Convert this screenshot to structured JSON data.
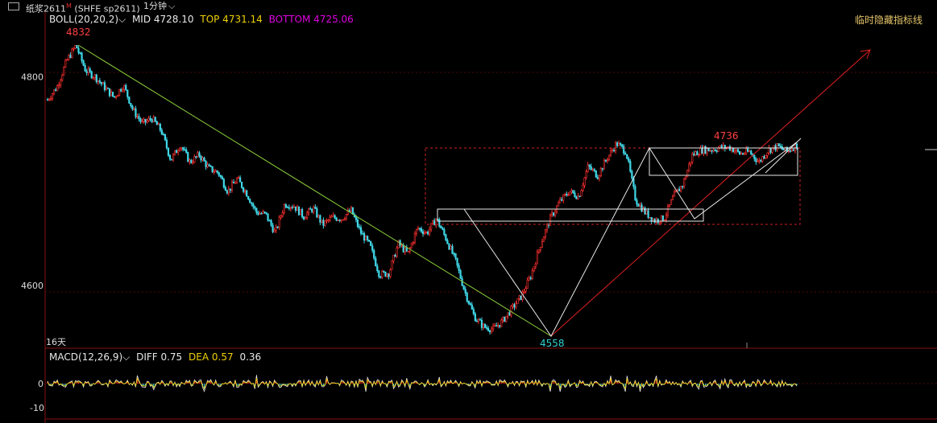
{
  "header": {
    "symbol": "纸浆2611",
    "symbol_mark": "M",
    "exchange": "(SHFE sp2611)",
    "timeframe": "1分钟"
  },
  "boll": {
    "label": "BOLL(20,20,2)",
    "mid": "MID 4728.10",
    "top": "TOP 4731.14",
    "bottom": "BOTTOM 4725.06",
    "colors": {
      "label": "#e8e8e8",
      "mid": "#e8e8e8",
      "top": "#f0d000",
      "bottom": "#e000e0"
    }
  },
  "hide_indicator_label": "临时隐藏指标线",
  "period_label": "16天",
  "macd": {
    "label": "MACD(12,26,9)",
    "diff": "DIFF 0.75",
    "dea": "DEA 0.57",
    "value": "0.36",
    "yticks": [
      "0",
      "-10"
    ]
  },
  "chart_data": {
    "type": "candlestick",
    "yticks": [
      4800,
      4600
    ],
    "ylim": [
      4542,
      4848
    ],
    "annotations": [
      {
        "text": "4832",
        "price": 4832,
        "color": "#ff4040"
      },
      {
        "text": "4736",
        "price": 4736,
        "color": "#ff4040"
      },
      {
        "text": "4558",
        "price": 4558,
        "color": "#30d0d0"
      }
    ],
    "series": [
      {
        "values": [
          4778,
          4790,
          4815,
          4830,
          4806,
          4800,
          4790,
          4780,
          4792,
          4768,
          4755,
          4760,
          4748,
          4720,
          4735,
          4718,
          4725,
          4712,
          4708,
          4690,
          4702,
          4688,
          4670,
          4668,
          4650,
          4678,
          4676,
          4666,
          4674,
          4658,
          4665,
          4664,
          4672,
          4651,
          4638,
          4610,
          4612,
          4640,
          4630,
          4655,
          4650,
          4664,
          4645,
          4624,
          4594,
          4570,
          4560,
          4558,
          4566,
          4578,
          4590,
          4610,
          4640,
          4664,
          4680,
          4690,
          4685,
          4714,
          4705,
          4722,
          4736,
          4728,
          4682,
          4670,
          4662,
          4664,
          4685,
          4697,
          4725,
          4730,
          4730,
          4732,
          4732,
          4726,
          4728,
          4718,
          4730,
          4733,
          4728,
          4735
        ]
      }
    ]
  }
}
